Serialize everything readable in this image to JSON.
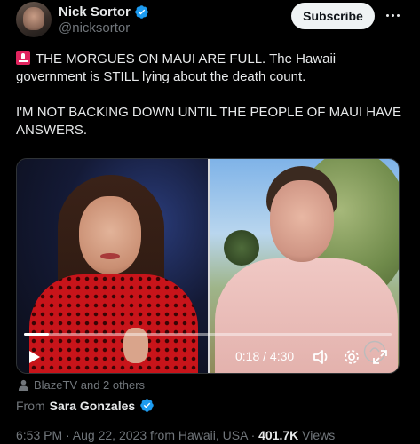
{
  "author": {
    "display_name": "Nick Sortor",
    "handle": "@nicksortor"
  },
  "subscribe_label": "Subscribe",
  "tweet": {
    "line1": "THE MORGUES ON MAUI ARE FULL. The Hawaii government is STILL lying about the death count.",
    "line2": "I'M NOT BACKING DOWN UNTIL THE PEOPLE OF MAUI HAVE ANSWERS."
  },
  "video": {
    "time": "0:18 / 4:30",
    "progress_fraction": 0.067
  },
  "liked_by": "BlazeTV and 2 others",
  "from": {
    "prefix": "From",
    "source": "Sara Gonzales"
  },
  "meta": {
    "posted": "6:53 PM · Aug 22, 2023 from Hawaii, USA · ",
    "views_count": "401.7K",
    "views_label": " Views"
  },
  "colors": {
    "verified": "#1d9bf0",
    "muted": "#71767b",
    "text": "#e7e9ea"
  }
}
